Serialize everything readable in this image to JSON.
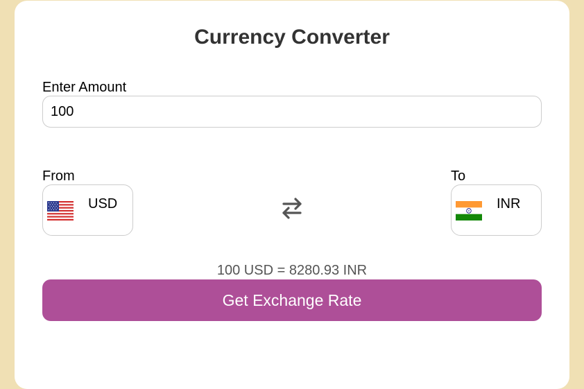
{
  "converter": {
    "title": "Currency Converter",
    "amount_label": "Enter Amount",
    "amount_value": "100",
    "from_label": "From",
    "to_label": "To",
    "from_currency": {
      "code": "USD",
      "flag_icon": "us-flag-icon"
    },
    "to_currency": {
      "code": "INR",
      "flag_icon": "india-flag-icon"
    },
    "swap_icon": "swap-arrows-icon",
    "result_text": "100 USD = 8280.93 INR",
    "button_label": "Get Exchange Rate"
  },
  "colors": {
    "page_background": "#f0e0b4",
    "card_background": "#ffffff",
    "button_background": "#ae4f98",
    "button_text": "#ffffff",
    "title_text": "#333333",
    "result_text": "#555555"
  }
}
